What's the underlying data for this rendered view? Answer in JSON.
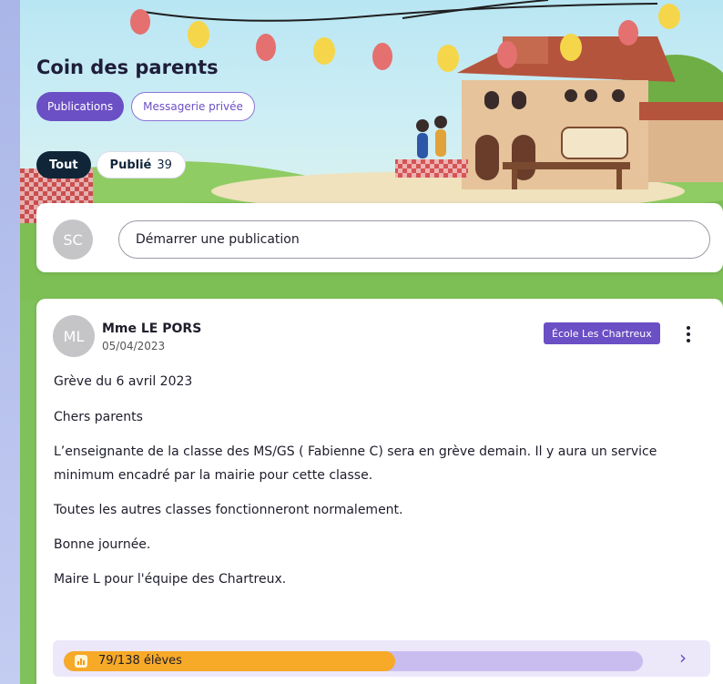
{
  "header": {
    "title": "Coin des parents",
    "tabs": [
      {
        "label": "Publications",
        "active": true
      },
      {
        "label": "Messagerie privée",
        "active": false
      }
    ]
  },
  "filters": {
    "all_label": "Tout",
    "published_label": "Publié",
    "published_count": "39"
  },
  "composer": {
    "avatar_initials": "SC",
    "placeholder": "Démarrer une publication"
  },
  "post": {
    "avatar_initials": "ML",
    "author": "Mme LE PORS",
    "date": "05/04/2023",
    "school_badge": "École Les Chartreux",
    "title": "Grève du 6 avril 2023",
    "paragraphs": [
      "Chers parents",
      "L’enseignante de la classe des MS/GS ( Fabienne C) sera en grève demain. Il y aura un service minimum encadré par la mairie pour cette classe.",
      "Toutes les autres classes fonctionneront normalement.",
      "Bonne journée.",
      "Maire L pour l'équipe des Chartreux."
    ],
    "readers": {
      "label": "79/138 élèves",
      "read": 79,
      "total": 138
    }
  },
  "colors": {
    "accent": "#6b4fc4",
    "dark_chip": "#102538",
    "progress_fill": "#f7a928",
    "progress_track": "#c9bdf0"
  }
}
